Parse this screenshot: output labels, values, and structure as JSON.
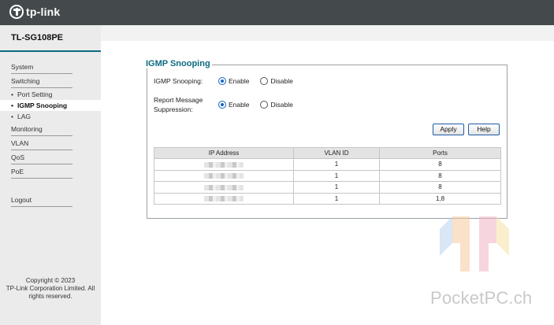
{
  "brand": {
    "logo_text": "tp-link"
  },
  "sidebar": {
    "model": "TL-SG108PE",
    "items": [
      {
        "label": "System",
        "type": "top"
      },
      {
        "label": "Switching",
        "type": "top"
      },
      {
        "label": "Port Setting",
        "type": "sub"
      },
      {
        "label": "IGMP Snooping",
        "type": "sub",
        "active": true
      },
      {
        "label": "LAG",
        "type": "sub"
      },
      {
        "label": "Monitoring",
        "type": "top"
      },
      {
        "label": "VLAN",
        "type": "top"
      },
      {
        "label": "QoS",
        "type": "top"
      },
      {
        "label": "PoE",
        "type": "top"
      },
      {
        "label": "Logout",
        "type": "top"
      }
    ],
    "bullet": "•",
    "copyright": [
      "Copyright © 2023",
      "TP-Link Corporation Limited. All",
      "rights reserved."
    ]
  },
  "panel": {
    "title": "IGMP Snooping",
    "igmp_label": "IGMP Snooping:",
    "report_label_1": "Report Message",
    "report_label_2": "Suppression:",
    "enable": "Enable",
    "disable": "Disable",
    "igmp_selected": "Enable",
    "report_selected": "Enable",
    "apply": "Apply",
    "help": "Help"
  },
  "table": {
    "headers": [
      "IP Address",
      "VLAN ID",
      "Ports"
    ],
    "rows": [
      {
        "ip": "",
        "vlan": "1",
        "ports": "8"
      },
      {
        "ip": "",
        "vlan": "1",
        "ports": "8"
      },
      {
        "ip": "",
        "vlan": "1",
        "ports": "8"
      },
      {
        "ip": "",
        "vlan": "1",
        "ports": "1,8"
      }
    ]
  },
  "watermark": {
    "text": "PocketPC.ch"
  },
  "colors": {
    "accent": "#0b6b80",
    "topbar": "#444a4c",
    "radio": "#1565c0"
  }
}
